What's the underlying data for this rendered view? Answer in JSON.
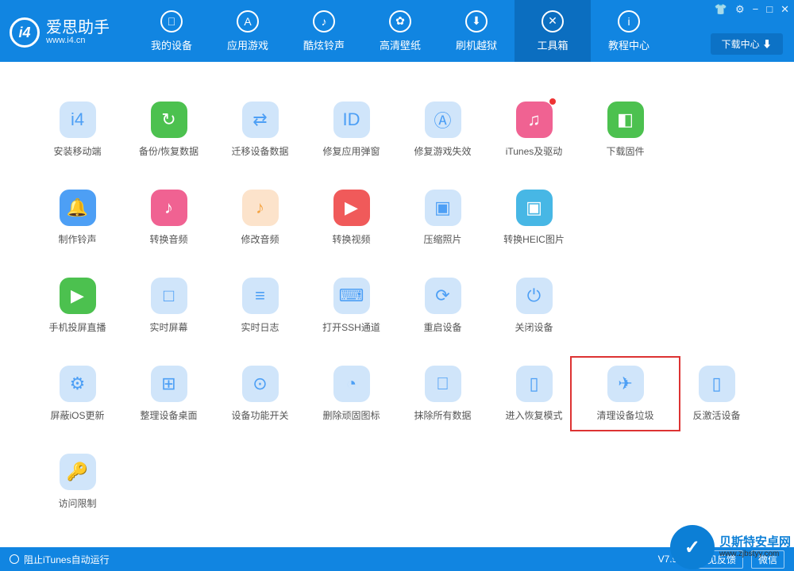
{
  "logo": {
    "icon": "i4",
    "cn": "爱思助手",
    "en": "www.i4.cn"
  },
  "nav": [
    {
      "label": "我的设备",
      "glyph": ""
    },
    {
      "label": "应用游戏",
      "glyph": "A"
    },
    {
      "label": "酷炫铃声",
      "glyph": "♪"
    },
    {
      "label": "高清壁纸",
      "glyph": "✿"
    },
    {
      "label": "刷机越狱",
      "glyph": "⬇"
    },
    {
      "label": "工具箱",
      "glyph": "✕",
      "active": true
    },
    {
      "label": "教程中心",
      "glyph": "i"
    }
  ],
  "win_controls": {
    "tshirt": "👕",
    "gear": "⚙",
    "min": "−",
    "max": "□",
    "close": "✕"
  },
  "download_center": "下载中心 ⬇",
  "tools": [
    {
      "label": "安装移动端",
      "color": "c-lblue",
      "glyph": "i4"
    },
    {
      "label": "备份/恢复数据",
      "color": "c-green",
      "glyph": "↻"
    },
    {
      "label": "迁移设备数据",
      "color": "c-lblue",
      "glyph": "⇄"
    },
    {
      "label": "修复应用弹窗",
      "color": "c-lblue",
      "glyph": "ID"
    },
    {
      "label": "修复游戏失效",
      "color": "c-lblue",
      "glyph": "Ⓐ"
    },
    {
      "label": "iTunes及驱动",
      "color": "c-pink",
      "glyph": "♫",
      "dot": true
    },
    {
      "label": "下载固件",
      "color": "c-green",
      "glyph": "◧"
    },
    {
      "label": "",
      "blank": true
    },
    {
      "label": "制作铃声",
      "color": "c-blue",
      "glyph": "🔔"
    },
    {
      "label": "转换音频",
      "color": "c-pink",
      "glyph": "♪"
    },
    {
      "label": "修改音频",
      "color": "c-lorange",
      "glyph": "♪"
    },
    {
      "label": "转换视频",
      "color": "c-red",
      "glyph": "▶"
    },
    {
      "label": "压缩照片",
      "color": "c-lblue",
      "glyph": "▣"
    },
    {
      "label": "转换HEIC图片",
      "color": "c-cyan",
      "glyph": "▣"
    },
    {
      "label": "",
      "blank": true
    },
    {
      "label": "",
      "blank": true
    },
    {
      "label": "手机投屏直播",
      "color": "c-green",
      "glyph": "▶"
    },
    {
      "label": "实时屏幕",
      "color": "c-lblue",
      "glyph": "□"
    },
    {
      "label": "实时日志",
      "color": "c-lblue",
      "glyph": "≡"
    },
    {
      "label": "打开SSH通道",
      "color": "c-lblue",
      "glyph": "⌨"
    },
    {
      "label": "重启设备",
      "color": "c-lblue",
      "glyph": "⟳"
    },
    {
      "label": "关闭设备",
      "color": "c-lblue",
      "glyph": "⏻"
    },
    {
      "label": "",
      "blank": true
    },
    {
      "label": "",
      "blank": true
    },
    {
      "label": "屏蔽iOS更新",
      "color": "c-lblue",
      "glyph": "⚙"
    },
    {
      "label": "整理设备桌面",
      "color": "c-lblue",
      "glyph": "⊞"
    },
    {
      "label": "设备功能开关",
      "color": "c-lblue",
      "glyph": "⊙"
    },
    {
      "label": "删除顽固图标",
      "color": "c-lblue",
      "glyph": "◔"
    },
    {
      "label": "抹除所有数据",
      "color": "c-lblue",
      "glyph": ""
    },
    {
      "label": "进入恢复模式",
      "color": "c-lblue",
      "glyph": "▯"
    },
    {
      "label": "清理设备垃圾",
      "color": "c-lblue",
      "glyph": "✈",
      "highlight": true
    },
    {
      "label": "反激活设备",
      "color": "c-lblue",
      "glyph": "▯"
    },
    {
      "label": "访问限制",
      "color": "c-lblue",
      "glyph": "🔑"
    },
    {
      "label": "",
      "blank": true
    },
    {
      "label": "",
      "blank": true
    },
    {
      "label": "",
      "blank": true
    },
    {
      "label": "",
      "blank": true
    },
    {
      "label": "",
      "blank": true
    },
    {
      "label": "",
      "blank": true
    },
    {
      "label": "",
      "blank": true
    }
  ],
  "footer": {
    "block_itunes": "阻止iTunes自动运行",
    "version": "V7.90",
    "feedback": "意见反馈",
    "wechat": "微信"
  },
  "watermark": {
    "circle": "✓",
    "line1": "贝斯特安卓网",
    "line2": "www.zjbstyy.com"
  }
}
